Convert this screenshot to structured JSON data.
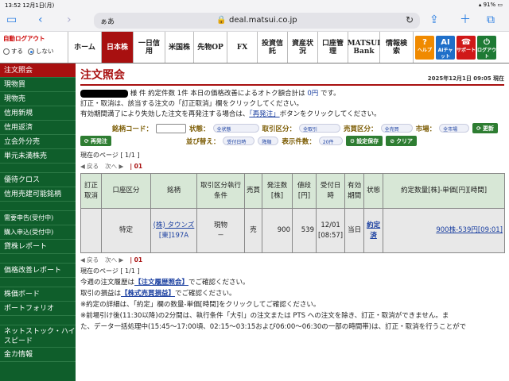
{
  "ios": {
    "time": "13:52",
    "date": "12月1日(月)",
    "battery": "91%"
  },
  "browser": {
    "reader_label": "ぁあ",
    "url": "deal.matsui.co.jp"
  },
  "nav": {
    "autologout_title": "自動ログアウト",
    "opt_on": "する",
    "opt_off": "しない",
    "tabs": [
      "ホーム",
      "日本株",
      "一日信用",
      "米国株",
      "先物OP",
      "FX",
      "投資信託",
      "資産状況",
      "口座管理",
      "MATSUI Bank",
      "情報検索"
    ],
    "help": "ヘルプ",
    "ai": "AIチャット",
    "support": "サポート",
    "logout": "ログアウト"
  },
  "sidebar": {
    "items": [
      "注文照会",
      "現物買",
      "現物売",
      "信用新規",
      "信用返済",
      "立会外分売",
      "単元未満株売",
      "",
      "優待クロス",
      "信用売建可能銘柄",
      "",
      "需要申告(受付中)",
      "購入申込(受付中)",
      "貸株レポート",
      "",
      "価格改善レポート",
      "",
      "株価ボード",
      "ポートフォリオ",
      "",
      "ネットストック・ハイスピード",
      "金カ情報"
    ]
  },
  "page": {
    "title": "注文照会",
    "datetime": "2025年12月1日 09:05 現在",
    "info1_pre": "様 ",
    "info1_mid": "件 約定件数 1件 本日の価格改善によるオトク額合計は",
    "info1_amount": "0円",
    "info1_post": "です。",
    "info2": "訂正・取消は、該当する注文の「訂正取消」欄をクリックしてください。",
    "info3_pre": "有効期間満了により失効した注文を再発注する場合は、",
    "info3_btn": "「再発注」",
    "info3_post": "ボタンをクリックしてください。",
    "filter": {
      "code_label": "銘柄コード：",
      "state_label": "状態：",
      "state_val": "全状態",
      "kind_label": "取引区分：",
      "kind_val": "全取引",
      "buysell_label": "売買区分：",
      "buysell_val": "全売買",
      "market_label": "市場：",
      "market_val": "全市場",
      "refresh": "更新",
      "reorder": "再発注",
      "sort_label": "並び替え：",
      "sort1": "受付日時",
      "sort2": "降順",
      "count_label": "表示件数：",
      "count_val": "20件",
      "save": "設定保存",
      "clear": "クリア"
    },
    "pager": "現在のページ [ 1/1 ]",
    "prev": "戻る",
    "next": "次へ",
    "page_num": "01"
  },
  "table": {
    "headers": [
      "訂正取消",
      "口座区分",
      "銘柄",
      "取引区分執行条件",
      "売買",
      "発注数[株]",
      "値段[円]",
      "受付日時",
      "有効期間",
      "状態",
      "約定数量[株]-単価[円][時間]"
    ],
    "rows": [
      {
        "cancel": "",
        "account": "特定",
        "stock_name": "(株) タウンズ",
        "stock_code": "[東]197A",
        "trade": "現物",
        "condition": "－",
        "side": "売",
        "qty": "900",
        "price": "539",
        "date": "12/01",
        "time": "[08:57]",
        "validity": "当日",
        "status": "約定済",
        "exec": "900株-539円[09:01]"
      }
    ]
  },
  "footer": {
    "pager": "現在のページ [ 1/1 ]",
    "note1_pre": "今週の注文履歴は",
    "note1_link": "【注文履歴照会】",
    "note1_post": "でご確認ください。",
    "note2_pre": "取引の損益は",
    "note2_link": "【株式売買損益】",
    "note2_post": "でご確認ください。",
    "note3": "※約定の詳細は、「約定」欄の数量-単価[時間]をクリックしてご確認ください。",
    "note4": "※前場引け後(11:30以降)の2分間は、執行条件「大引」の注文または PTS への注文を除き、訂正・取消ができません。ま",
    "note5": "た、データ一括処理中(15:45～17:00頃、02:15～03:15および06:00～06:30の一部の時間帯)は、訂正・取消を行うことがで"
  },
  "colors": {
    "brand_red": "#a81010",
    "sidebar_green": "#0f5e2b",
    "header_green": "#d7e7d6",
    "link_blue": "#1a3fa0"
  }
}
